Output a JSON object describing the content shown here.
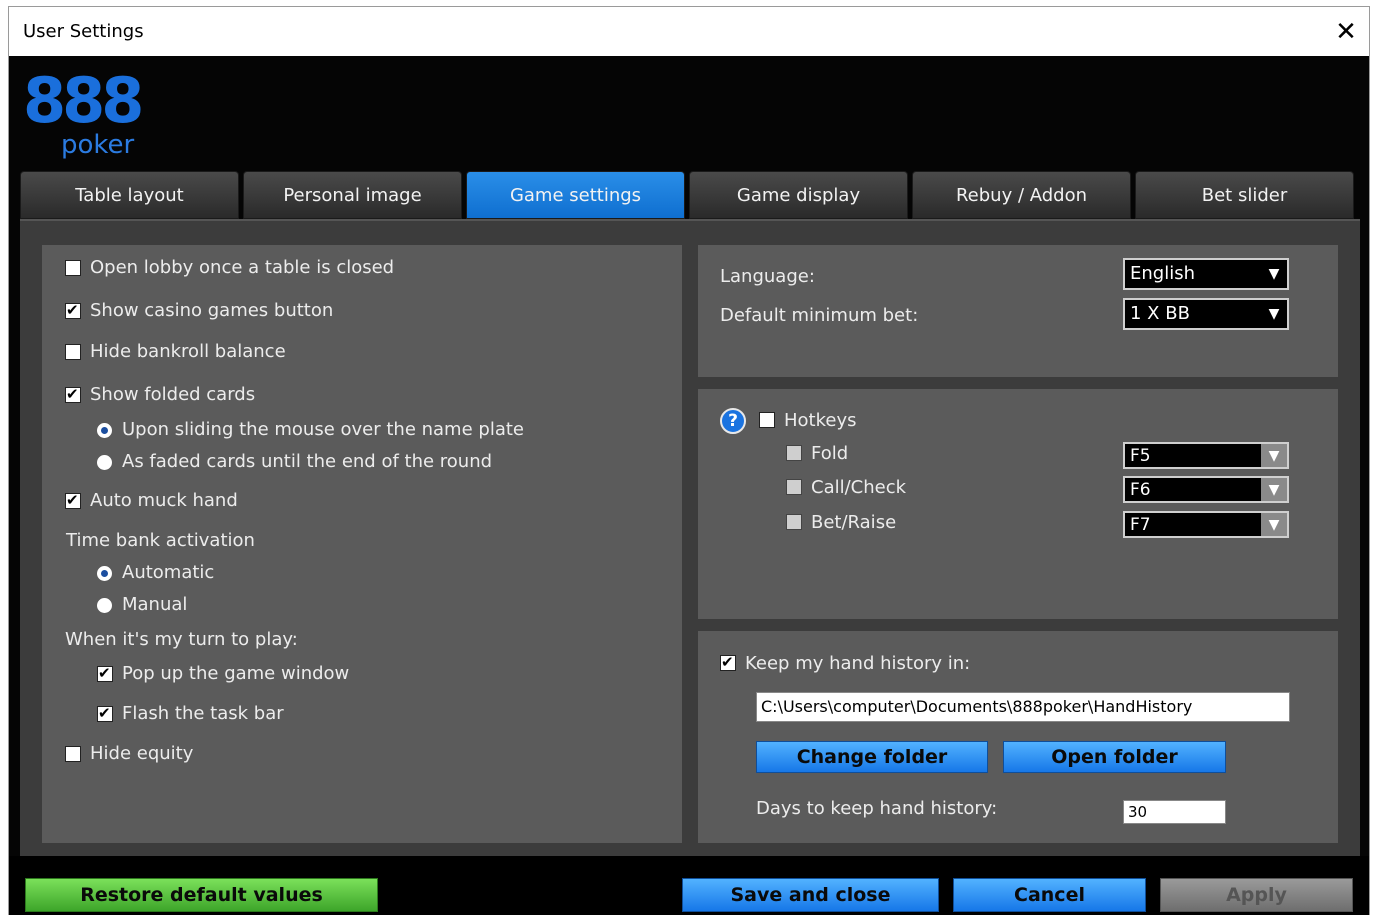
{
  "window": {
    "title": "User Settings",
    "close_symbol": "✕"
  },
  "logo": {
    "number": "888",
    "word": "poker",
    "brand_color": "#1a6fdc"
  },
  "tabs": [
    {
      "label": "Table layout",
      "active": false
    },
    {
      "label": "Personal image",
      "active": false
    },
    {
      "label": "Game settings",
      "active": true
    },
    {
      "label": "Game display",
      "active": false
    },
    {
      "label": "Rebuy / Addon",
      "active": false
    },
    {
      "label": "Bet slider",
      "active": false
    }
  ],
  "left_panel": {
    "open_lobby": {
      "label": "Open lobby once a table is closed",
      "checked": false
    },
    "show_casino": {
      "label": "Show casino games button",
      "checked": true
    },
    "hide_bankroll": {
      "label": "Hide bankroll balance",
      "checked": false
    },
    "show_folded": {
      "label": "Show folded cards",
      "checked": true
    },
    "folded_opt1": {
      "label": "Upon sliding the mouse over the name plate",
      "selected": true
    },
    "folded_opt2": {
      "label": "As faded cards until the end of the round",
      "selected": false
    },
    "auto_muck": {
      "label": "Auto muck hand",
      "checked": true
    },
    "time_bank_heading": "Time bank activation",
    "time_bank_auto": {
      "label": "Automatic",
      "selected": true
    },
    "time_bank_manual": {
      "label": "Manual",
      "selected": false
    },
    "turn_heading": "When it's my turn to play:",
    "popup_window": {
      "label": "Pop up the game window",
      "checked": true
    },
    "flash_taskbar": {
      "label": "Flash the task bar",
      "checked": true
    },
    "hide_equity": {
      "label": "Hide equity",
      "checked": false
    }
  },
  "language_panel": {
    "language_label": "Language:",
    "language_value": "English",
    "min_bet_label": "Default minimum bet:",
    "min_bet_value": "1 X BB"
  },
  "hotkeys_panel": {
    "help_symbol": "?",
    "hotkeys_label": "Hotkeys",
    "fold_label": "Fold",
    "fold_key": "F5",
    "call_label": "Call/Check",
    "call_key": "F6",
    "bet_label": "Bet/Raise",
    "bet_key": "F7"
  },
  "history_panel": {
    "keep_label": "Keep my hand history in:",
    "keep_checked": true,
    "path": "C:\\Users\\computer\\Documents\\888poker\\HandHistory",
    "change_folder": "Change folder",
    "open_folder": "Open folder",
    "days_label": "Days to keep hand history:",
    "days_value": "30"
  },
  "footer": {
    "restore": "Restore default values",
    "save_close": "Save and close",
    "cancel": "Cancel",
    "apply": "Apply"
  }
}
